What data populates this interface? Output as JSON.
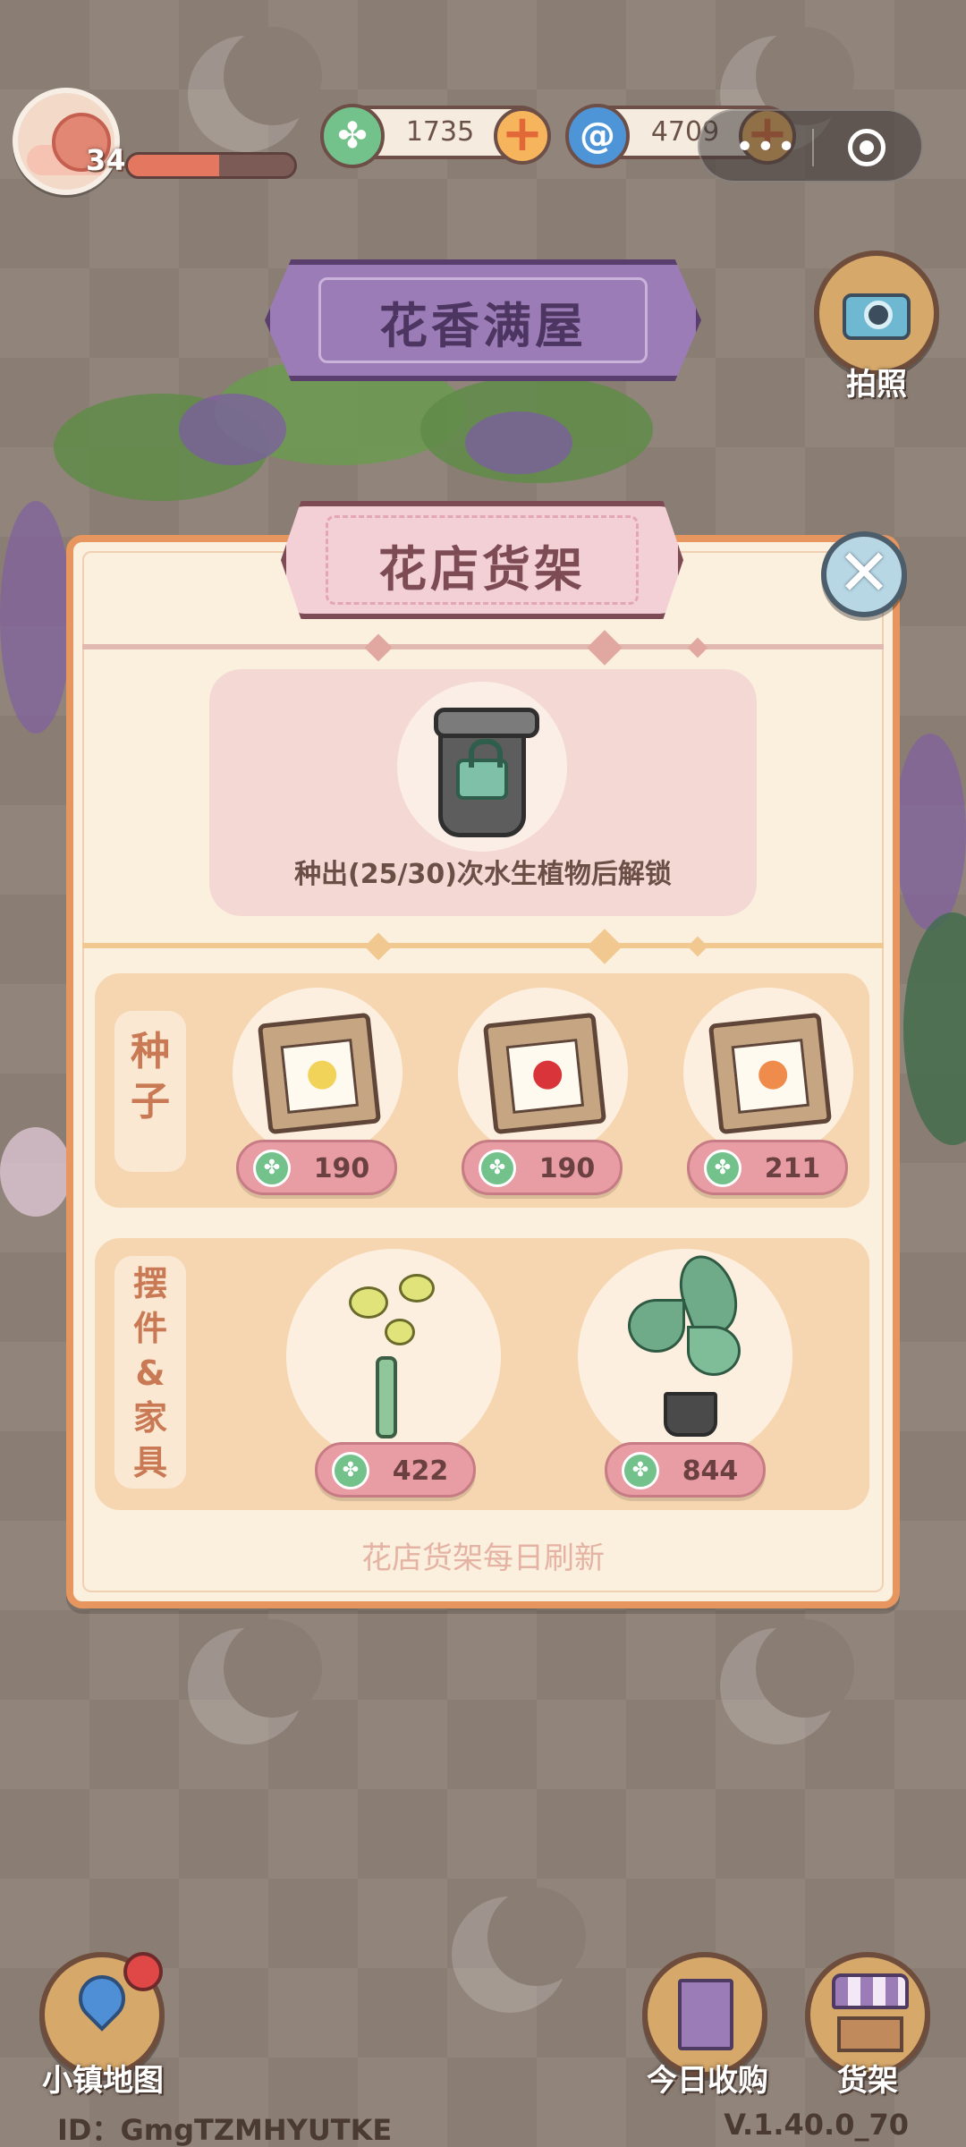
{
  "hud": {
    "level": "34",
    "xp_fraction": 0.55,
    "clover_amount": "1735",
    "swirl_amount": "4709",
    "capsule_more": "•••"
  },
  "title_banner": "花香满屋",
  "camera_label": "拍照",
  "panel": {
    "title": "花店货架",
    "close_icon_glyph": "✕",
    "locked_slot": {
      "unlock_text": "种出(25/30)次水生植物后解锁"
    },
    "seeds": {
      "label": [
        "种",
        "子"
      ],
      "items": [
        {
          "price": "190",
          "flower_color": "#f2d35a"
        },
        {
          "price": "190",
          "flower_color": "#d8343a"
        },
        {
          "price": "211",
          "flower_color": "#f08c4b"
        }
      ]
    },
    "decor": {
      "label": [
        "摆",
        "件",
        "&",
        "家",
        "具"
      ],
      "items": [
        {
          "price": "422"
        },
        {
          "price": "844"
        }
      ]
    },
    "refresh_note": "花店货架每日刷新"
  },
  "bottom": {
    "map_label": "小镇地图",
    "today_label": "今日收购",
    "shelf_label": "货架"
  },
  "footer": {
    "id_text": "ID：GmgTZMHYUTKE",
    "version": "V.1.40.0_70"
  },
  "colors": {
    "panel_border": "#e8965f",
    "price_pill": "#e89ca3",
    "clover_green": "#74c28b",
    "swirl_blue": "#4e95d8"
  }
}
